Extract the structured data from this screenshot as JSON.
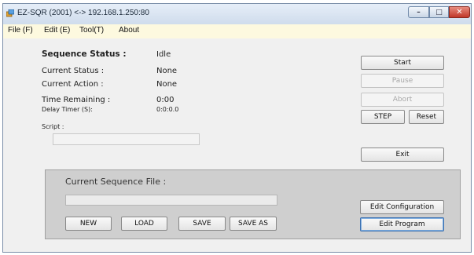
{
  "window": {
    "title": "EZ-SQR (2001) <-> 192.168.1.250:80"
  },
  "menu": {
    "items": [
      "File (F)",
      "Edit (E)",
      "Tool(T)",
      "About"
    ]
  },
  "status": {
    "sequence_status_label": "Sequence Status :",
    "sequence_status_value": "Idle",
    "current_status_label": "Current Status :",
    "current_status_value": "None",
    "current_action_label": "Current Action :",
    "current_action_value": "None",
    "time_remaining_label": "Time Remaining :",
    "time_remaining_value": "0:00",
    "delay_timer_label": "Delay Timer (S):",
    "delay_timer_value": "0:0:0.0",
    "script_label": "Script :",
    "script_value": ""
  },
  "controls": {
    "start": "Start",
    "pause": "Pause",
    "abort": "Abort",
    "step": "STEP",
    "reset": "Reset",
    "exit": "Exit"
  },
  "sequence_file": {
    "label": "Current Sequence File :",
    "value": "",
    "new": "NEW",
    "load": "LOAD",
    "save": "SAVE",
    "save_as": "SAVE AS",
    "edit_configuration": "Edit Configuration",
    "edit_program": "Edit Program"
  },
  "icons": {
    "app": "app-icon",
    "minimize": "minimize-icon",
    "maximize": "maximize-icon",
    "close": "close-icon"
  }
}
